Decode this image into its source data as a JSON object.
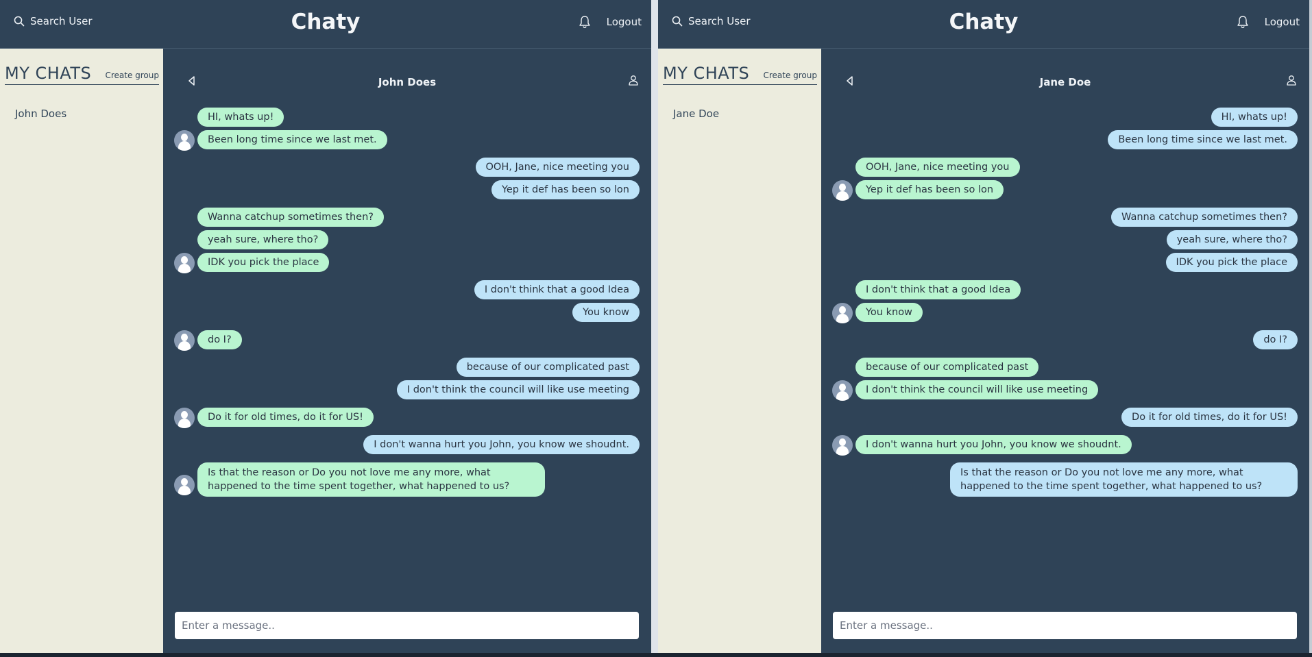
{
  "app_title": "Chaty",
  "search_label": "Search User",
  "logout_label": "Logout",
  "my_chats_label": "MY CHATS",
  "create_group_label": "Create group",
  "input_placeholder": "Enter a message..",
  "colors": {
    "pane_bg": "#2f4357",
    "sidebar_bg": "#ececde",
    "own_bubble": "#bee3f8",
    "other_bubble": "#b9f5d0"
  },
  "icons": {
    "search": "search-icon",
    "bell": "bell-icon",
    "back": "back-icon",
    "profile": "user-icon",
    "avatar": "user-avatar"
  },
  "left_pane": {
    "chat_name": "John Does",
    "chat_list": [
      "John Does"
    ],
    "messages": [
      "HI, whats up!",
      "Been long time since we last met.",
      "OOH, Jane, nice meeting you",
      "Yep it def has been so lon",
      "Wanna catchup sometimes then?",
      "yeah sure, where tho?",
      "IDK you pick the place",
      "I don't think that a good Idea",
      "You know",
      "do I?",
      "because of our complicated past",
      "I don't think the council will like use meeting",
      "Do it for old times, do it for US!",
      "I don't wanna hurt you John, you know we shoudnt.",
      "Is that the reason or Do you not love me any more, what happened to the time spent together, what happened to us?"
    ]
  },
  "right_pane": {
    "chat_name": "Jane Doe",
    "chat_list": [
      "Jane Doe"
    ],
    "messages": [
      "HI, whats up!",
      "Been long time since we last met.",
      "OOH, Jane, nice meeting you",
      "Yep it def has been so lon",
      "Wanna catchup sometimes then?",
      "yeah sure, where tho?",
      "IDK you pick the place",
      "I don't think that a good Idea",
      "You know",
      "do I?",
      "because of our complicated past",
      "I don't think the council will like use meeting",
      "Do it for old times, do it for US!",
      "I don't wanna hurt you John, you know we shoudnt.",
      "Is that the reason or Do you not love me any more, what happened to the time spent together, what happened to us?"
    ]
  }
}
